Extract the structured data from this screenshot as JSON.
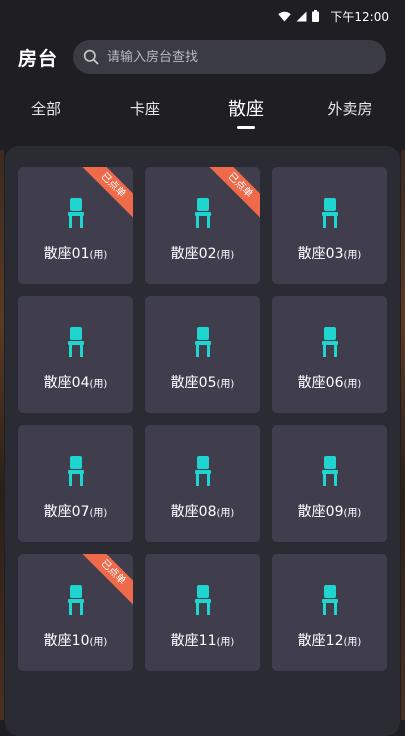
{
  "status_bar": {
    "time": "下午12:00"
  },
  "header": {
    "title": "房台",
    "search_placeholder": "请输入房台查找"
  },
  "tabs": [
    {
      "label": "全部",
      "active": false
    },
    {
      "label": "卡座",
      "active": false
    },
    {
      "label": "散座",
      "active": true
    },
    {
      "label": "外卖房",
      "active": false
    }
  ],
  "tables": [
    {
      "name": "散座01",
      "tag": "(用)",
      "badge": "已点单"
    },
    {
      "name": "散座02",
      "tag": "(用)",
      "badge": "已点单"
    },
    {
      "name": "散座03",
      "tag": "(用)",
      "badge": ""
    },
    {
      "name": "散座04",
      "tag": "(用)",
      "badge": ""
    },
    {
      "name": "散座05",
      "tag": "(用)",
      "badge": ""
    },
    {
      "name": "散座06",
      "tag": "(用)",
      "badge": ""
    },
    {
      "name": "散座07",
      "tag": "(用)",
      "badge": ""
    },
    {
      "name": "散座08",
      "tag": "(用)",
      "badge": ""
    },
    {
      "name": "散座09",
      "tag": "(用)",
      "badge": ""
    },
    {
      "name": "散座10",
      "tag": "(用)",
      "badge": "已点单"
    },
    {
      "name": "散座11",
      "tag": "(用)",
      "badge": ""
    },
    {
      "name": "散座12",
      "tag": "(用)",
      "badge": ""
    }
  ],
  "colors": {
    "chair_icon": "#1ed6cf",
    "badge": "#ef6a4a",
    "card": "#403e4c",
    "panel": "#2b2b33",
    "background": "#1f1f23"
  },
  "icons": {
    "search": "search-icon",
    "chair": "chair-icon",
    "wifi": "wifi-icon",
    "signal": "signal-icon",
    "battery": "battery-icon"
  }
}
